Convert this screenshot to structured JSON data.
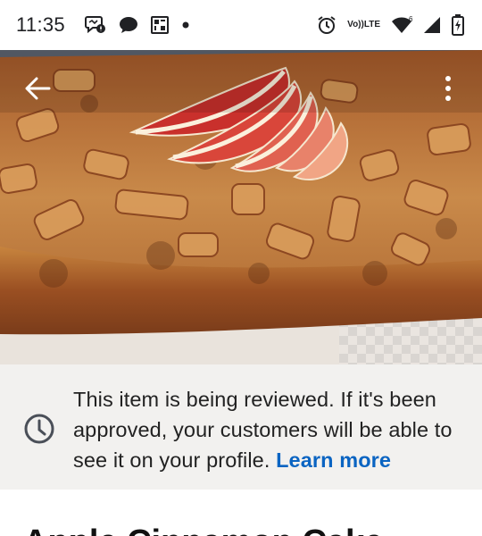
{
  "status_bar": {
    "time": "11:35",
    "network_label_top": "Vo))",
    "network_label_bottom": "LTE",
    "signal_superscript": "6",
    "icons": [
      "messenger-icon",
      "chat-bubble-icon",
      "app-grid-icon",
      "dot-icon",
      "alarm-icon",
      "wifi-icon",
      "cell-signal-icon",
      "battery-charging-icon"
    ]
  },
  "toolbar": {
    "back_icon": "back-arrow-icon",
    "more_icon": "more-vertical-icon"
  },
  "review_banner": {
    "icon": "clock-icon",
    "message": "This item is being reviewed. If it's been approved, your customers will be able to see it on your profile.",
    "link_label": "Learn more",
    "link_color": "#0a64c2"
  },
  "item": {
    "title": "Apple Cinnamon Cake"
  }
}
